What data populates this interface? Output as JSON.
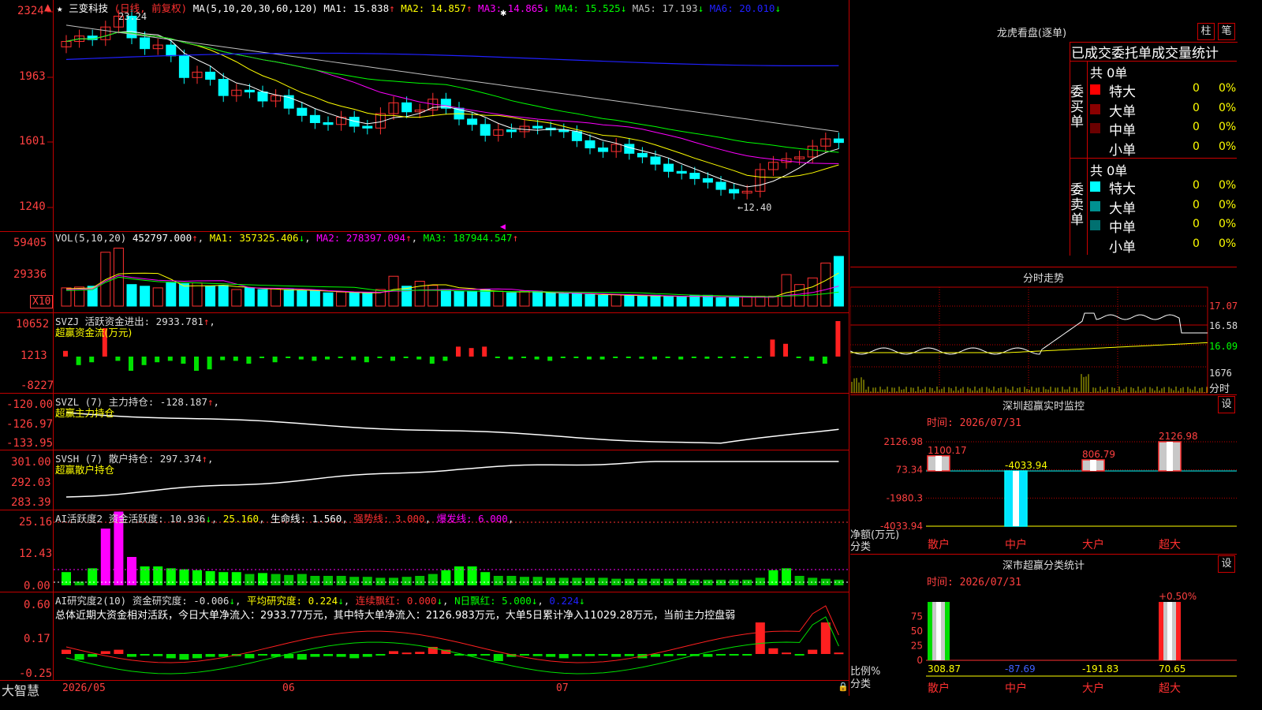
{
  "main": {
    "stock_name": "三变科技",
    "period": "(日线, 前复权)",
    "ma_params": "MA(5,10,20,30,60,120)",
    "ma": [
      {
        "label": "MA1:",
        "value": "15.838",
        "dir": "↑",
        "color": "#ffffff"
      },
      {
        "label": "MA2:",
        "value": "14.857",
        "dir": "↑",
        "color": "#ffff00"
      },
      {
        "label": "MA3:",
        "value": "14.865",
        "dir": "↓",
        "color": "#ff00ff"
      },
      {
        "label": "MA4:",
        "value": "15.525",
        "dir": "↓",
        "color": "#00ff00"
      },
      {
        "label": "MA5:",
        "value": "17.193",
        "dir": "↓",
        "color": "#c0c0c0"
      },
      {
        "label": "MA6:",
        "value": "20.010",
        "dir": "↓",
        "color": "#2020ff"
      }
    ],
    "y_labels": [
      "2324",
      "1963",
      "1601",
      "1240"
    ],
    "high_label": "23.24",
    "low_label": "←12.40"
  },
  "vol": {
    "label": "VOL(5,10,20)",
    "value": "452797.000",
    "ma1": "MA1: 357325.406",
    "ma2": "MA2: 278397.094",
    "ma3": "MA3: 187944.547",
    "y_labels": [
      "59405",
      "29336"
    ],
    "unit": "X10"
  },
  "svzj": {
    "label": "SVZJ  活跃资金进出: 2933.781",
    "sub": "超赢资金流(万元)",
    "y_labels": [
      "10652",
      "1213",
      "-8227"
    ]
  },
  "svzl": {
    "label": "SVZL (7) 主力持仓: -128.187",
    "sub": "超赢主力持仓",
    "y_labels": [
      "-120.00",
      "-126.97",
      "-133.95"
    ]
  },
  "svsh": {
    "label": "SVSH (7) 散户持仓: 297.374",
    "sub": "超赢散户持仓",
    "y_labels": [
      "301.00",
      "292.03",
      "283.39"
    ]
  },
  "ai1": {
    "label": "AI活跃度2 资金活跃度: 10.936",
    "v2": "25.160",
    "v3": "生命线: 1.560",
    "v4": "强势线: 3.000",
    "v5": "爆发线: 6.000",
    "y_labels": [
      "25.16",
      "12.43",
      "0.00"
    ]
  },
  "ai2": {
    "label": "AI研究度2(10) 资金研究度: -0.006",
    "v2": "平均研究度: 0.224",
    "v3": "连续飘红: 0.000",
    "v4": "N日飘红: 5.000",
    "v5": "0.224",
    "summary": "总体近期大资金相对活跃，今日大单净流入：2933.77万元，其中特大单净流入：2126.983万元，大单5日累计净入11029.28万元，当前主力控盘弱",
    "y_labels": [
      "0.60",
      "0.17",
      "-0.25"
    ]
  },
  "bottom": {
    "brand": "大智慧",
    "dates": [
      "2026/05",
      "06",
      "07"
    ]
  },
  "dragon": {
    "title": "龙虎看盘(逐单)",
    "btn1": "柱",
    "btn2": "笔",
    "subtitle": "已成交委托单成交量统计",
    "buy_group": "委买单",
    "sell_group": "委卖单",
    "buy_total": "共 0单",
    "sell_total": "共 0单",
    "buy_rows": [
      {
        "name": "特大",
        "count": "0",
        "pct": "0%",
        "color": "#ff0000"
      },
      {
        "name": "大单",
        "count": "0",
        "pct": "0%",
        "color": "#8b0000"
      },
      {
        "name": "中单",
        "count": "0",
        "pct": "0%",
        "color": "#6b0000"
      },
      {
        "name": "小单",
        "count": "0",
        "pct": "0%",
        "color": ""
      }
    ],
    "sell_rows": [
      {
        "name": "特大",
        "count": "0",
        "pct": "0%",
        "color": "#00ffff"
      },
      {
        "name": "大单",
        "count": "0",
        "pct": "0%",
        "color": "#009090"
      },
      {
        "name": "中单",
        "count": "0",
        "pct": "0%",
        "color": "#007070"
      },
      {
        "name": "小单",
        "count": "0",
        "pct": "0%",
        "color": ""
      }
    ]
  },
  "intraday": {
    "title": "分时走势",
    "y_labels": [
      "17.07",
      "16.58",
      "16.09"
    ],
    "vol_label": "1676",
    "time_label": "分时"
  },
  "monitor": {
    "title": "深圳超赢实时监控",
    "btn": "设",
    "date": "时间: 2026/07/31",
    "y_labels": [
      "2126.98",
      "73.34",
      "-1980.3",
      "-4033.94"
    ],
    "ylabel": "净额(万元)",
    "xlabel": "分类",
    "categories": [
      "散户",
      "中户",
      "大户",
      "超大"
    ],
    "values": [
      1100.17,
      -4033.94,
      806.79,
      2126.98
    ],
    "value_labels": [
      "1100.17",
      "-4033.94",
      "806.79",
      "2126.98"
    ]
  },
  "classify": {
    "title": "深市超赢分类统计",
    "btn": "设",
    "date": "时间: 2026/07/31",
    "y_labels": [
      "75",
      "50",
      "25",
      "0"
    ],
    "ylabel": "比例%",
    "xlabel": "分类",
    "categories": [
      "散户",
      "中户",
      "大户",
      "超大"
    ],
    "values": [
      308.87,
      -87.69,
      -191.83,
      70.65
    ],
    "value_labels": [
      "308.87",
      "-87.69",
      "-191.83",
      "70.65"
    ],
    "pct_label": "+0.50%"
  },
  "chart_data": [
    {
      "type": "bar",
      "title": "深圳超赢实时监控",
      "ylabel": "净额(万元)",
      "xlabel": "分类",
      "categories": [
        "散户",
        "中户",
        "大户",
        "超大"
      ],
      "values": [
        1100.17,
        -4033.94,
        806.79,
        2126.98
      ],
      "ylim": [
        -4033.94,
        2126.98
      ]
    },
    {
      "type": "bar",
      "title": "深市超赢分类统计",
      "ylabel": "比例%",
      "xlabel": "分类",
      "categories": [
        "散户",
        "中户",
        "大户",
        "超大"
      ],
      "values": [
        308.87,
        -87.69,
        -191.83,
        70.65
      ],
      "ylim": [
        0,
        100
      ]
    },
    {
      "type": "line",
      "title": "三变科技 (日线, 前复权)",
      "ylim": [
        12.4,
        23.24
      ],
      "annotations": [
        "23.24",
        "←12.40"
      ]
    }
  ]
}
